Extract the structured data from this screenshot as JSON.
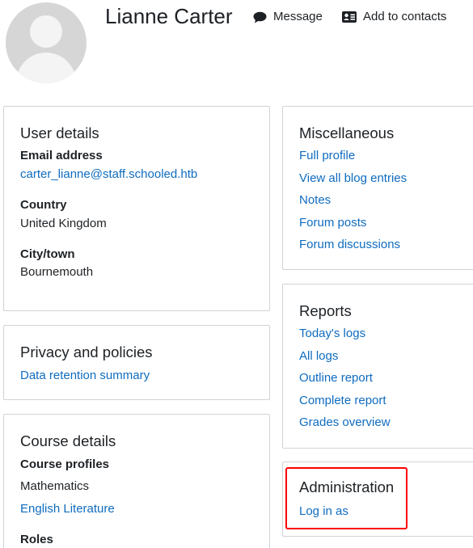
{
  "profile": {
    "name": "Lianne Carter",
    "message_label": "Message",
    "add_contacts_label": "Add to contacts"
  },
  "user_details": {
    "title": "User details",
    "email_label": "Email address",
    "email_value": "carter_lianne@staff.schooled.htb",
    "country_label": "Country",
    "country_value": "United Kingdom",
    "city_label": "City/town",
    "city_value": "Bournemouth"
  },
  "privacy": {
    "title": "Privacy and policies",
    "links": [
      "Data retention summary"
    ]
  },
  "course_details": {
    "title": "Course details",
    "profiles_label": "Course profiles",
    "courses": [
      "Mathematics",
      "English Literature"
    ],
    "roles_label": "Roles"
  },
  "miscellaneous": {
    "title": "Miscellaneous",
    "links": [
      "Full profile",
      "View all blog entries",
      "Notes",
      "Forum posts",
      "Forum discussions"
    ]
  },
  "reports": {
    "title": "Reports",
    "links": [
      "Today's logs",
      "All logs",
      "Outline report",
      "Complete report",
      "Grades overview"
    ]
  },
  "administration": {
    "title": "Administration",
    "links": [
      "Log in as"
    ]
  },
  "colors": {
    "link": "#0f6cbf",
    "text": "#1d2125",
    "border": "#d0d3d6",
    "highlight": "#ff0000"
  }
}
